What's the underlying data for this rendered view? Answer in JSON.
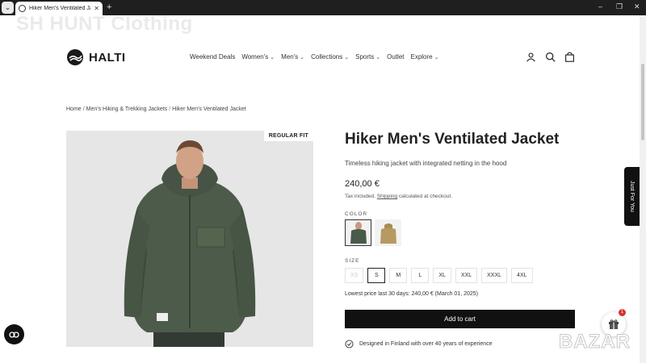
{
  "browser": {
    "tab_title": "Hiker Men's Ventilated Jacket",
    "new_tab": "+",
    "controls": [
      "–",
      "❐",
      "✕"
    ]
  },
  "watermark": "SH HUNT Clothing",
  "header": {
    "brand": "HALTI",
    "nav": [
      {
        "label": "Weekend Deals",
        "dropdown": false
      },
      {
        "label": "Women's",
        "dropdown": true
      },
      {
        "label": "Men's",
        "dropdown": true
      },
      {
        "label": "Collections",
        "dropdown": true
      },
      {
        "label": "Sports",
        "dropdown": true
      },
      {
        "label": "Outlet",
        "dropdown": false
      },
      {
        "label": "Explore",
        "dropdown": true
      }
    ],
    "icons": [
      "user-icon",
      "search-icon",
      "cart-icon"
    ]
  },
  "breadcrumb": [
    "Home",
    "Men's Hiking & Trekking Jackets",
    "Hiker Men's Ventilated Jacket"
  ],
  "product": {
    "badge": "REGULAR FIT",
    "badge_image_text": "HALTI",
    "title": "Hiker Men's Ventilated Jacket",
    "subtitle": "Timeless hiking jacket with integrated netting in the hood",
    "price": "240,00 €",
    "tax_prefix": "Tax included.",
    "tax_link": "Shipping",
    "tax_suffix": "calculated at checkout.",
    "color_label": "COLOR",
    "colors": [
      {
        "name": "green",
        "hex": "#4a5a48",
        "selected": true
      },
      {
        "name": "sand",
        "hex": "#b59a62",
        "selected": false
      }
    ],
    "size_label": "SIZE",
    "sizes": [
      {
        "label": "XS",
        "state": "disabled"
      },
      {
        "label": "S",
        "state": "selected"
      },
      {
        "label": "M",
        "state": "available"
      },
      {
        "label": "L",
        "state": "available"
      },
      {
        "label": "XL",
        "state": "available"
      },
      {
        "label": "XXL",
        "state": "available"
      },
      {
        "label": "XXXL",
        "state": "available"
      },
      {
        "label": "4XL",
        "state": "available"
      }
    ],
    "lowest_price": "Lowest price last 30 days: 240,00 € (March 01, 2025)",
    "add_to_cart": "Add to cart",
    "designed": "Designed in Finland with over 40 years of experience"
  },
  "side_tab": "Just For You",
  "floating": {
    "gift_badge": "1",
    "bazar_logo": "BAZAR"
  }
}
